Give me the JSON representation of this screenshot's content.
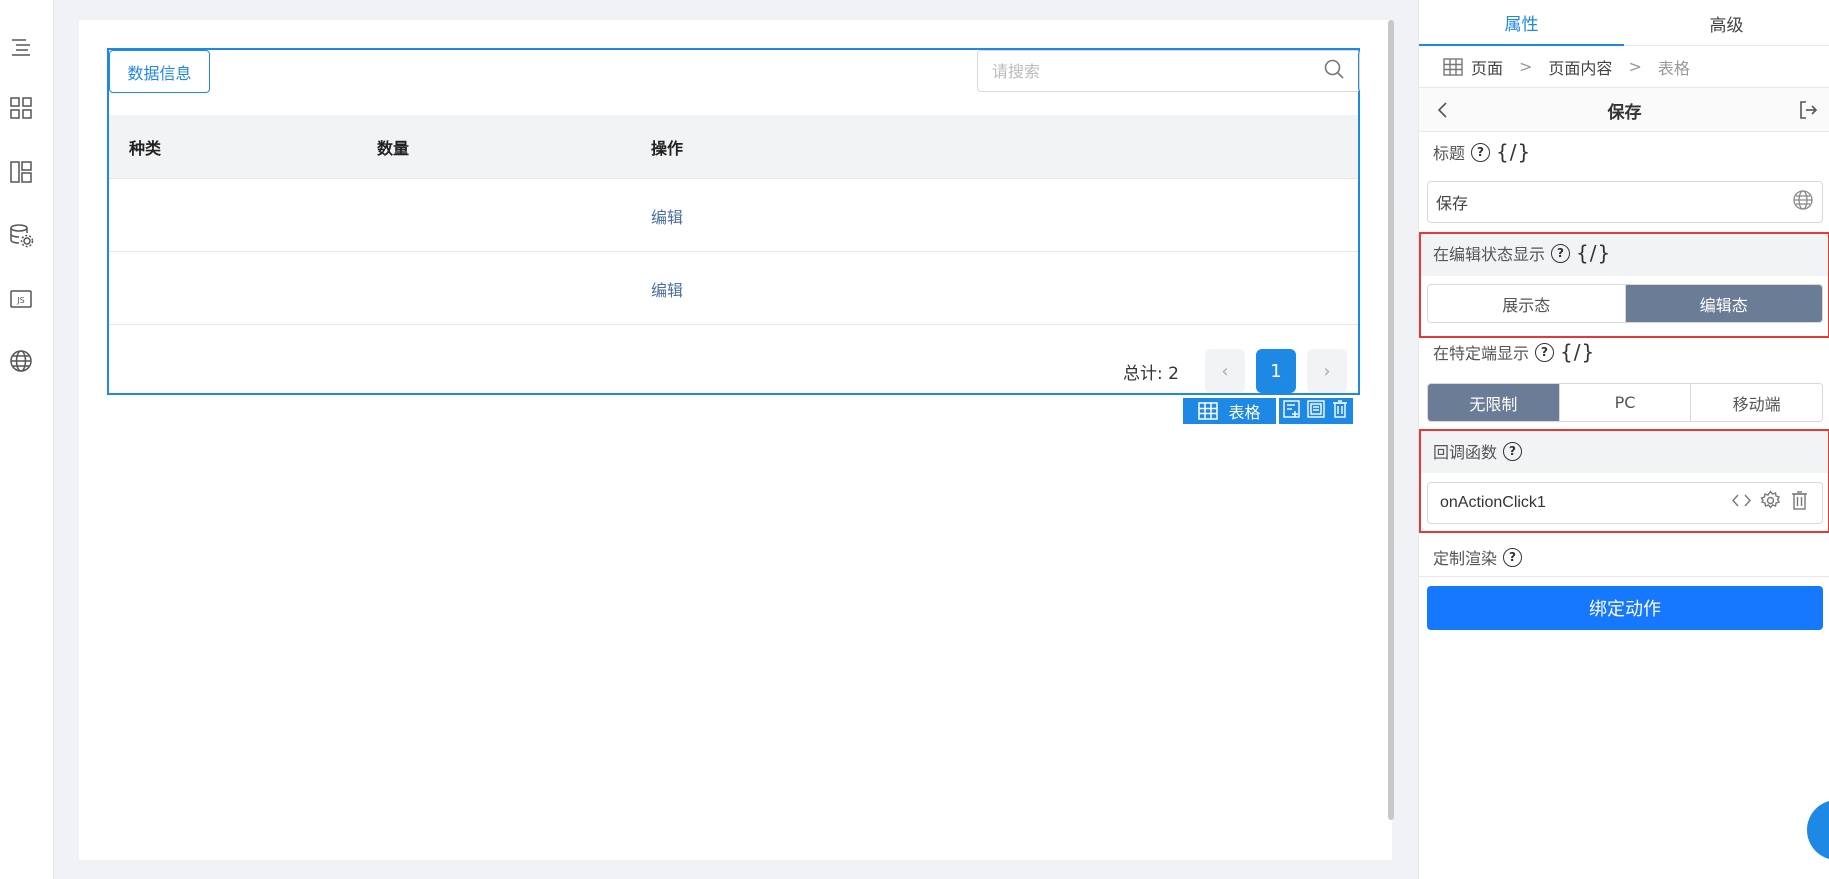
{
  "left_rail": [
    {
      "name": "outline-icon"
    },
    {
      "name": "components-icon"
    },
    {
      "name": "layout-icon"
    },
    {
      "name": "datasource-icon"
    },
    {
      "name": "js-icon",
      "text": "JS"
    },
    {
      "name": "i18n-icon"
    }
  ],
  "canvas": {
    "table": {
      "tab_label": "数据信息",
      "search_placeholder": "请搜索",
      "columns": [
        "种类",
        "数量",
        "操作"
      ],
      "rows": [
        {
          "action": "编辑"
        },
        {
          "action": "编辑"
        }
      ],
      "pager": {
        "total_label": "总计: 2",
        "current_page": "1",
        "prev": "‹",
        "next": "›"
      }
    },
    "component_toolbar": {
      "label": "表格"
    }
  },
  "panel": {
    "tabs": [
      {
        "label": "属性",
        "active": true
      },
      {
        "label": "高级",
        "active": false
      }
    ],
    "breadcrumb": [
      "页面",
      "页面内容",
      "表格"
    ],
    "header_title": "保存",
    "title_field": {
      "label": "标题",
      "value": "保存"
    },
    "edit_state": {
      "label": "在编辑状态显示",
      "options": [
        {
          "label": "展示态",
          "selected": false
        },
        {
          "label": "编辑态",
          "selected": true
        }
      ]
    },
    "platform": {
      "label": "在特定端显示",
      "options": [
        {
          "label": "无限制",
          "selected": true
        },
        {
          "label": "PC",
          "selected": false
        },
        {
          "label": "移动端",
          "selected": false
        }
      ]
    },
    "callback": {
      "label": "回调函数",
      "value": "onActionClick1"
    },
    "custom_render": {
      "label": "定制渲染"
    },
    "bind_button": "绑定动作",
    "expr_icon": "{/}",
    "help_icon": "?"
  },
  "colors": {
    "accent": "#1e88e5",
    "selected_seg": "#6b7d96",
    "highlight": "#e53935"
  }
}
